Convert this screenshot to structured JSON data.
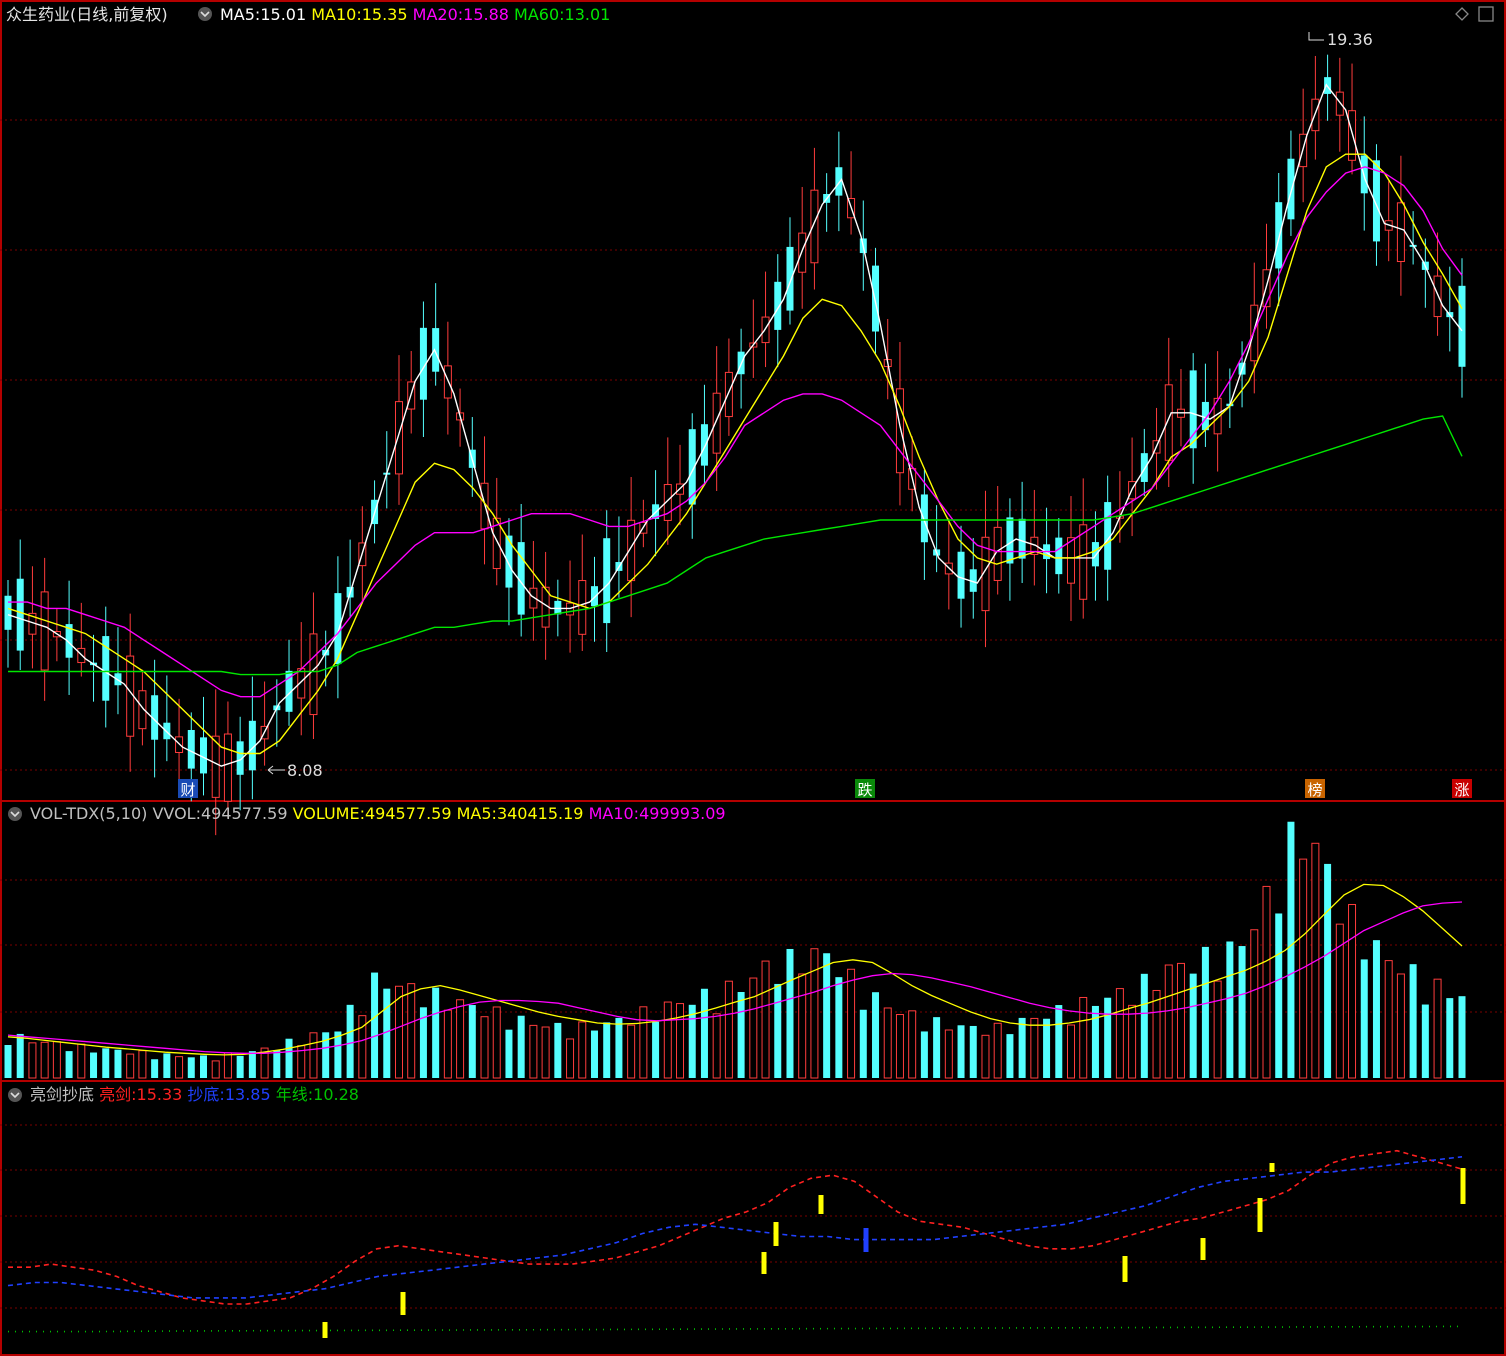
{
  "stock_title": "众生药业(日线,前复权)",
  "price_panel": {
    "legend": [
      {
        "label": "MA5:",
        "value": "15.01",
        "color": "#ffffff"
      },
      {
        "label": "MA10:",
        "value": "15.35",
        "color": "#ffff00"
      },
      {
        "label": "MA20:",
        "value": "15.88",
        "color": "#ff00ff"
      },
      {
        "label": "MA60:",
        "value": "13.01",
        "color": "#00e600"
      }
    ],
    "high_label": "19.36",
    "low_label": "8.08",
    "markers": [
      {
        "label": "财",
        "color": "#1a4bb5"
      },
      {
        "label": "跌",
        "color": "#0a8a0a"
      },
      {
        "label": "榜",
        "color": "#c86400"
      },
      {
        "label": "涨",
        "color": "#c80000"
      }
    ]
  },
  "volume_panel": {
    "legend": [
      {
        "label": "VOL-TDX(5,10)",
        "value": "",
        "color": "#c0c0c0"
      },
      {
        "label": "VVOL:",
        "value": "494577.59",
        "color": "#c0c0c0"
      },
      {
        "label": "VOLUME:",
        "value": "494577.59",
        "color": "#ffff00"
      },
      {
        "label": "MA5:",
        "value": "340415.19",
        "color": "#ffff00"
      },
      {
        "label": "MA10:",
        "value": "499993.09",
        "color": "#ff00ff"
      }
    ]
  },
  "indicator_panel": {
    "legend": [
      {
        "label": "亮剑抄底",
        "value": "",
        "color": "#c0c0c0"
      },
      {
        "label": "亮剑:",
        "value": "15.33",
        "color": "#ff2020"
      },
      {
        "label": "抄底:",
        "value": "13.85",
        "color": "#2040ff"
      },
      {
        "label": "年线:",
        "value": "10.28",
        "color": "#00c000"
      }
    ]
  },
  "colors": {
    "up": "#ff3c3c",
    "down": "#54ffff",
    "grid": "#7a0000",
    "border": "#b40000",
    "ma5": "#ffffff",
    "ma10": "#ffff00",
    "ma20": "#ff00ff",
    "ma60": "#00e600"
  },
  "chart_data": [
    {
      "type": "candlestick",
      "title": "众生药业(日线,前复权)",
      "ylim": [
        7.8,
        19.8
      ],
      "series": [
        {
          "name": "MA5",
          "values": [
            10.5,
            10.4,
            10.3,
            10.1,
            9.8,
            9.6,
            9.4,
            9.0,
            8.7,
            8.4,
            8.25,
            8.1,
            8.2,
            8.5,
            9.1,
            9.4,
            9.7,
            10.2,
            11.2,
            12.2,
            13.2,
            14.2,
            14.7,
            14.0,
            12.9,
            11.8,
            11.2,
            10.8,
            10.6,
            10.6,
            10.7,
            11.0,
            11.5,
            12.0,
            12.3,
            12.6,
            13.2,
            13.9,
            14.6,
            15.0,
            15.5,
            16.3,
            17.0,
            17.4,
            16.5,
            15.1,
            13.5,
            12.2,
            11.4,
            11.1,
            11.0,
            11.5,
            11.7,
            11.6,
            11.4,
            11.4,
            11.4,
            11.8,
            12.5,
            13.0,
            13.7,
            13.7,
            13.6,
            13.8,
            14.7,
            15.8,
            17.0,
            18.1,
            18.9,
            18.5,
            17.4,
            16.7,
            16.6,
            16.1,
            15.4,
            15.0
          ]
        },
        {
          "name": "MA10",
          "values": [
            10.6,
            10.5,
            10.4,
            10.3,
            10.2,
            10.0,
            9.8,
            9.6,
            9.3,
            9.0,
            8.7,
            8.4,
            8.3,
            8.3,
            8.5,
            8.9,
            9.3,
            9.8,
            10.5,
            11.2,
            11.9,
            12.6,
            12.9,
            12.8,
            12.5,
            12.1,
            11.6,
            11.2,
            10.8,
            10.7,
            10.6,
            10.7,
            11.0,
            11.3,
            11.7,
            12.1,
            12.6,
            13.1,
            13.6,
            14.1,
            14.6,
            15.2,
            15.5,
            15.4,
            15.0,
            14.5,
            13.8,
            13.0,
            12.3,
            11.7,
            11.4,
            11.3,
            11.4,
            11.5,
            11.4,
            11.4,
            11.5,
            11.7,
            12.1,
            12.5,
            13.0,
            13.2,
            13.5,
            13.8,
            14.2,
            14.9,
            15.9,
            16.9,
            17.6,
            17.8,
            17.8,
            17.5,
            17.0,
            16.4,
            15.9,
            15.35
          ]
        },
        {
          "name": "MA20",
          "values": [
            10.7,
            10.7,
            10.6,
            10.6,
            10.5,
            10.4,
            10.3,
            10.1,
            9.9,
            9.7,
            9.5,
            9.3,
            9.2,
            9.2,
            9.4,
            9.6,
            9.9,
            10.2,
            10.6,
            11.0,
            11.3,
            11.6,
            11.8,
            11.8,
            11.8,
            11.9,
            12.0,
            12.1,
            12.1,
            12.1,
            12.0,
            11.9,
            11.9,
            12.0,
            12.1,
            12.3,
            12.6,
            13.0,
            13.5,
            13.7,
            13.9,
            14.0,
            14.0,
            13.9,
            13.7,
            13.5,
            13.1,
            12.7,
            12.3,
            11.9,
            11.6,
            11.5,
            11.5,
            11.5,
            11.5,
            11.7,
            11.9,
            12.1,
            12.3,
            12.5,
            12.9,
            13.3,
            13.7,
            14.2,
            14.8,
            15.5,
            16.2,
            16.8,
            17.2,
            17.5,
            17.6,
            17.5,
            17.3,
            16.9,
            16.3,
            15.88
          ]
        },
        {
          "name": "MA60",
          "values": [
            9.6,
            9.6,
            9.6,
            9.6,
            9.6,
            9.6,
            9.6,
            9.6,
            9.6,
            9.6,
            9.6,
            9.6,
            9.55,
            9.55,
            9.55,
            9.6,
            9.6,
            9.7,
            9.9,
            10.0,
            10.1,
            10.2,
            10.3,
            10.3,
            10.35,
            10.4,
            10.4,
            10.45,
            10.5,
            10.55,
            10.6,
            10.7,
            10.8,
            10.9,
            11.0,
            11.2,
            11.4,
            11.5,
            11.6,
            11.7,
            11.75,
            11.8,
            11.85,
            11.9,
            11.95,
            12.0,
            12.0,
            12.0,
            12.0,
            12.0,
            12.0,
            12.0,
            12.0,
            12.0,
            12.0,
            12.0,
            12.0,
            12.05,
            12.1,
            12.2,
            12.3,
            12.4,
            12.5,
            12.6,
            12.7,
            12.8,
            12.9,
            13.0,
            13.1,
            13.2,
            13.3,
            13.4,
            13.5,
            13.6,
            13.65,
            13.01
          ]
        }
      ],
      "annotations": [
        "19.36",
        "8.08"
      ]
    },
    {
      "type": "bar",
      "title": "VOL-TDX(5,10)",
      "series": [
        {
          "name": "VOLUME",
          "values": [
            80,
            70,
            65,
            60,
            55,
            52,
            50,
            45,
            42,
            40,
            38,
            40,
            45,
            50,
            60,
            70,
            80,
            90,
            140,
            180,
            170,
            160,
            150,
            140,
            130,
            120,
            110,
            100,
            95,
            90,
            95,
            100,
            110,
            120,
            130,
            140,
            150,
            160,
            170,
            200,
            210,
            220,
            230,
            200,
            160,
            140,
            120,
            110,
            100,
            95,
            90,
            90,
            100,
            110,
            120,
            130,
            140,
            150,
            160,
            180,
            200,
            210,
            220,
            230,
            260,
            330,
            420,
            450,
            380,
            300,
            260,
            220,
            200,
            180,
            160,
            150
          ]
        },
        {
          "name": "MA5",
          "values": [
            75,
            72,
            68,
            64,
            60,
            56,
            53,
            50,
            47,
            45,
            43,
            42,
            43,
            47,
            52,
            59,
            67,
            78,
            92,
            120,
            148,
            162,
            168,
            160,
            150,
            140,
            130,
            120,
            112,
            106,
            100,
            98,
            99,
            103,
            109,
            117,
            127,
            138,
            148,
            164,
            180,
            195,
            210,
            215,
            210,
            190,
            168,
            150,
            135,
            120,
            108,
            100,
            96,
            96,
            100,
            106,
            115,
            126,
            136,
            148,
            160,
            172,
            184,
            196,
            212,
            232,
            262,
            298,
            333,
            352,
            350,
            330,
            304,
            272,
            240,
            340.4
          ]
        },
        {
          "name": "MA10",
          "values": [
            78,
            75,
            72,
            69,
            66,
            63,
            60,
            57,
            54,
            51,
            48,
            46,
            45,
            45,
            47,
            50,
            54,
            60,
            68,
            80,
            94,
            108,
            120,
            130,
            138,
            141,
            141,
            139,
            136,
            128,
            120,
            112,
            106,
            104,
            106,
            108,
            112,
            118,
            126,
            136,
            146,
            156,
            168,
            178,
            186,
            190,
            188,
            182,
            174,
            166,
            156,
            146,
            136,
            128,
            122,
            118,
            116,
            116,
            118,
            122,
            128,
            136,
            144,
            154,
            168,
            184,
            202,
            222,
            245,
            268,
            284,
            300,
            313,
            318,
            320,
            499.99
          ]
        }
      ]
    },
    {
      "type": "line",
      "title": "亮剑抄底",
      "series": [
        {
          "name": "亮剑",
          "values": [
            12.2,
            12.2,
            12.3,
            12.2,
            12.1,
            11.9,
            11.6,
            11.4,
            11.2,
            11.1,
            11.0,
            11.0,
            11.1,
            11.2,
            11.5,
            11.9,
            12.4,
            12.8,
            12.9,
            12.8,
            12.7,
            12.6,
            12.5,
            12.4,
            12.3,
            12.3,
            12.3,
            12.4,
            12.5,
            12.7,
            12.9,
            13.2,
            13.5,
            13.8,
            14.0,
            14.3,
            14.8,
            15.1,
            15.2,
            15.0,
            14.5,
            14.0,
            13.7,
            13.6,
            13.5,
            13.3,
            13.1,
            12.9,
            12.8,
            12.8,
            12.9,
            13.1,
            13.3,
            13.5,
            13.7,
            13.8,
            14.0,
            14.2,
            14.4,
            14.7,
            15.2,
            15.6,
            15.8,
            15.9,
            16.0,
            15.8,
            15.6,
            15.4,
            15.33
          ]
        },
        {
          "name": "抄底",
          "values": [
            11.6,
            11.7,
            11.7,
            11.6,
            11.5,
            11.4,
            11.3,
            11.2,
            11.2,
            11.2,
            11.3,
            11.4,
            11.5,
            11.7,
            11.9,
            12.0,
            12.1,
            12.2,
            12.3,
            12.4,
            12.5,
            12.6,
            12.8,
            13.0,
            13.3,
            13.5,
            13.6,
            13.5,
            13.4,
            13.3,
            13.2,
            13.2,
            13.1,
            13.1,
            13.1,
            13.1,
            13.2,
            13.3,
            13.4,
            13.5,
            13.6,
            13.8,
            14.0,
            14.2,
            14.5,
            14.8,
            15.0,
            15.1,
            15.2,
            15.3,
            15.3,
            15.4,
            15.5,
            15.6,
            15.7,
            15.8,
            13.85
          ]
        },
        {
          "name": "年线",
          "values": [
            10.1,
            10.1,
            10.12,
            10.13,
            10.14,
            10.15,
            10.16,
            10.17,
            10.18,
            10.19,
            10.2,
            10.21,
            10.22,
            10.23,
            10.24,
            10.25,
            10.26,
            10.27,
            10.28
          ]
        }
      ]
    }
  ]
}
